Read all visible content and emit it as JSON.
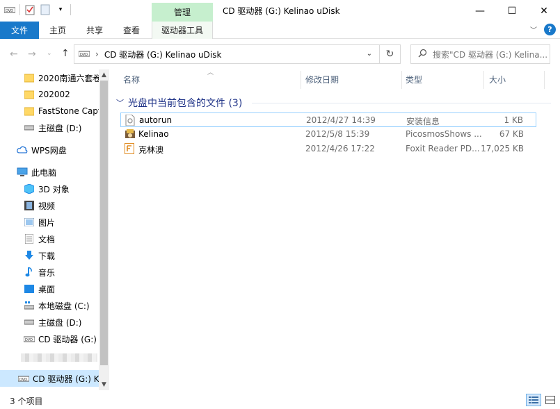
{
  "window": {
    "title": "CD 驱动器 (G:) Kelinao uDisk",
    "manage_tab": "管理",
    "controls": {
      "minimize": "—",
      "maximize": "☐",
      "close": "✕"
    }
  },
  "ribbon": {
    "tabs": [
      "文件",
      "主页",
      "共享",
      "查看",
      "驱动器工具"
    ]
  },
  "address": {
    "path": "CD 驱动器 (G:) Kelinao uDisk",
    "search_placeholder": "搜索\"CD 驱动器 (G:) Kelina..."
  },
  "sidebar": {
    "items": [
      {
        "label": "2020南通六套卷",
        "icon": "folder-icon"
      },
      {
        "label": "202002",
        "icon": "folder-icon"
      },
      {
        "label": "FastStone Capt",
        "icon": "folder-icon"
      },
      {
        "label": "主磁盘 (D:)",
        "icon": "drive-icon"
      },
      {
        "label": "WPS网盘",
        "icon": "cloud-icon"
      },
      {
        "label": "此电脑",
        "icon": "computer-icon"
      },
      {
        "label": "3D 对象",
        "icon": "cube-icon"
      },
      {
        "label": "视频",
        "icon": "video-icon"
      },
      {
        "label": "图片",
        "icon": "picture-icon"
      },
      {
        "label": "文档",
        "icon": "document-icon"
      },
      {
        "label": "下载",
        "icon": "download-icon"
      },
      {
        "label": "音乐",
        "icon": "music-icon"
      },
      {
        "label": "桌面",
        "icon": "desktop-icon"
      },
      {
        "label": "本地磁盘 (C:)",
        "icon": "system-drive-icon"
      },
      {
        "label": "主磁盘 (D:)",
        "icon": "drive-icon"
      },
      {
        "label": "CD 驱动器 (G:)",
        "icon": "cd-drive-icon"
      },
      {
        "label": "CD 驱动器 (G:) K",
        "icon": "cd-drive-icon"
      }
    ]
  },
  "columns": {
    "name": "名称",
    "date": "修改日期",
    "type": "类型",
    "size": "大小"
  },
  "group": {
    "label": "光盘中当前包含的文件 (3)"
  },
  "files": [
    {
      "name": "autorun",
      "date": "2012/4/27 14:39",
      "type": "安装信息",
      "size": "1 KB",
      "icon": "inf-file-icon"
    },
    {
      "name": "Kelinao",
      "date": "2012/5/8 15:39",
      "type": "PicosmosShows ...",
      "size": "67 KB",
      "icon": "image-app-icon"
    },
    {
      "name": "克林澳",
      "date": "2012/4/26 17:22",
      "type": "Foxit Reader PD...",
      "size": "17,025 KB",
      "icon": "pdf-file-icon"
    }
  ],
  "status": {
    "count": "3 个项目"
  }
}
